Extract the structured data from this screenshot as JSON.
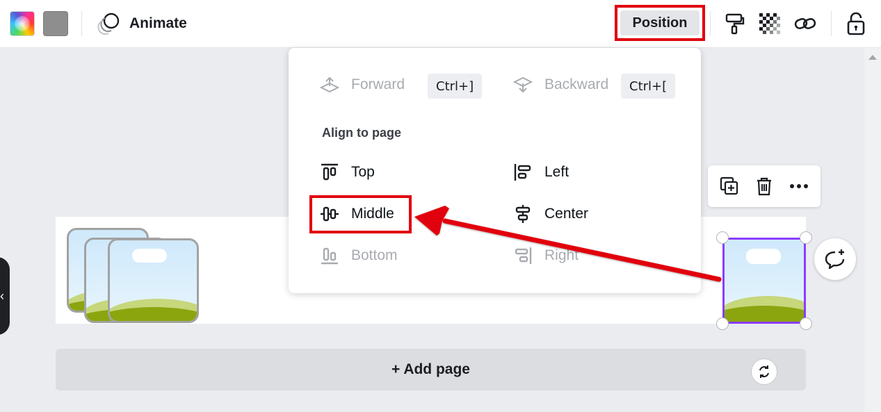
{
  "toolbar": {
    "animate_label": "Animate",
    "position_label": "Position"
  },
  "dropdown": {
    "forward_label": "Forward",
    "forward_shortcut": "Ctrl+]",
    "backward_label": "Backward",
    "backward_shortcut": "Ctrl+[",
    "align_title": "Align to page",
    "align_items": {
      "top": "Top",
      "left": "Left",
      "middle": "Middle",
      "center": "Center",
      "bottom": "Bottom",
      "right": "Right"
    }
  },
  "canvas": {
    "add_page_label": "+ Add page"
  },
  "colors": {
    "highlight": "#e1000f",
    "selection": "#8b3dff"
  }
}
